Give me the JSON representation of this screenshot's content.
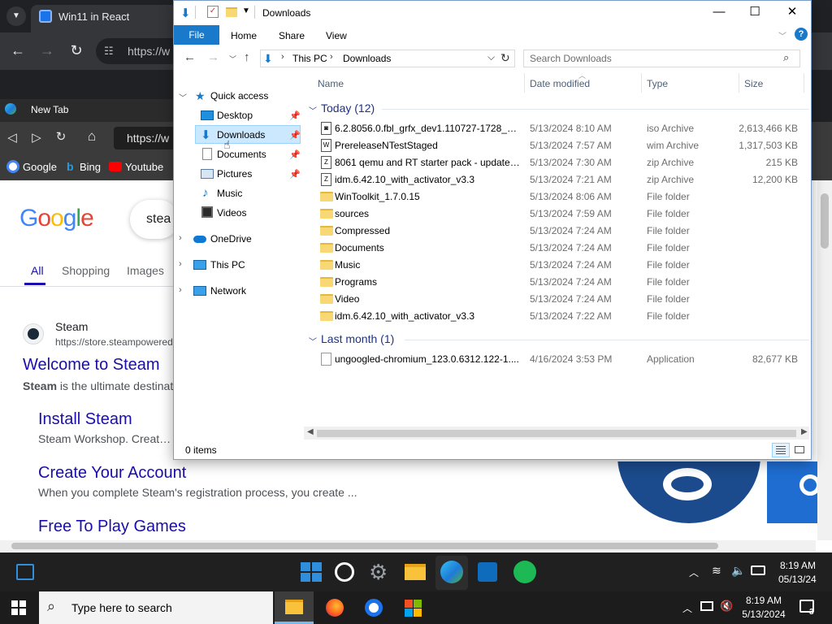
{
  "chrome": {
    "tab_title": "Win11 in React",
    "url": "https://w"
  },
  "edge": {
    "tab_title": "New Tab",
    "url": "https://w",
    "bookmarks": [
      "Google",
      "Bing",
      "Youtube"
    ]
  },
  "google": {
    "logo_letters": [
      "G",
      "o",
      "o",
      "g",
      "l",
      "e"
    ],
    "logo_colors": [
      "#4285f4",
      "#ea4335",
      "#fbbc05",
      "#4285f4",
      "#34a853",
      "#ea4335"
    ],
    "search_text": "stea",
    "tabs": [
      "All",
      "Shopping",
      "Images"
    ],
    "result": {
      "site_name": "Steam",
      "site_url": "https://store.steampowered",
      "title": "Welcome to Steam",
      "snippet_bold": "Steam",
      "snippet_rest": " is the ultimate destinat",
      "sublinks": [
        {
          "title": "Install Steam",
          "snippet": "Steam Workshop. Create, c"
        },
        {
          "title": "Create Your Account",
          "snippet": "When you complete Steam's registration process, you create ..."
        },
        {
          "title": "Free To Play Games",
          "snippet": ""
        }
      ]
    }
  },
  "explorer": {
    "title": "Downloads",
    "ribbon_tabs": [
      "File",
      "Home",
      "Share",
      "View"
    ],
    "help": "?",
    "breadcrumb": [
      "This PC",
      "Downloads"
    ],
    "search_placeholder": "Search Downloads",
    "nav": {
      "quick_access": "Quick access",
      "pinned": [
        "Desktop",
        "Downloads",
        "Documents",
        "Pictures"
      ],
      "unpinned": [
        "Music",
        "Videos"
      ],
      "onedrive": "OneDrive",
      "thispc": "This PC",
      "network": "Network"
    },
    "columns": [
      "Name",
      "Date modified",
      "Type",
      "Size"
    ],
    "groups": [
      {
        "label": "Today (12)",
        "files": [
          {
            "name": "6.2.8056.0.fbl_grfx_dev1.110727-1728_x86...",
            "date": "5/13/2024 8:10 AM",
            "type": "iso Archive",
            "size": "2,613,466 KB",
            "icon": "iso-file-icon"
          },
          {
            "name": "PrereleaseNTestStaged",
            "date": "5/13/2024 7:57 AM",
            "type": "wim Archive",
            "size": "1,317,503 KB",
            "icon": "wim-file-icon"
          },
          {
            "name": "8061 qemu and RT starter pack - updated...",
            "date": "5/13/2024 7:30 AM",
            "type": "zip Archive",
            "size": "215 KB",
            "icon": "zip-file-icon"
          },
          {
            "name": "idm.6.42.10_with_activator_v3.3",
            "date": "5/13/2024 7:21 AM",
            "type": "zip Archive",
            "size": "12,200 KB",
            "icon": "zip-file-icon"
          },
          {
            "name": "WinToolkit_1.7.0.15",
            "date": "5/13/2024 8:06 AM",
            "type": "File folder",
            "size": "",
            "icon": "folder-icon"
          },
          {
            "name": "sources",
            "date": "5/13/2024 7:59 AM",
            "type": "File folder",
            "size": "",
            "icon": "folder-icon"
          },
          {
            "name": "Compressed",
            "date": "5/13/2024 7:24 AM",
            "type": "File folder",
            "size": "",
            "icon": "folder-icon"
          },
          {
            "name": "Documents",
            "date": "5/13/2024 7:24 AM",
            "type": "File folder",
            "size": "",
            "icon": "folder-icon"
          },
          {
            "name": "Music",
            "date": "5/13/2024 7:24 AM",
            "type": "File folder",
            "size": "",
            "icon": "folder-icon"
          },
          {
            "name": "Programs",
            "date": "5/13/2024 7:24 AM",
            "type": "File folder",
            "size": "",
            "icon": "folder-icon"
          },
          {
            "name": "Video",
            "date": "5/13/2024 7:24 AM",
            "type": "File folder",
            "size": "",
            "icon": "folder-icon"
          },
          {
            "name": "idm.6.42.10_with_activator_v3.3",
            "date": "5/13/2024 7:22 AM",
            "type": "File folder",
            "size": "",
            "icon": "folder-icon"
          }
        ]
      },
      {
        "label": "Last month (1)",
        "files": [
          {
            "name": "ungoogled-chromium_123.0.6312.122-1....",
            "date": "4/16/2024 3:53 PM",
            "type": "Application",
            "size": "82,677 KB",
            "icon": "application-file-icon"
          }
        ]
      }
    ],
    "status": "0 items"
  },
  "taskbar11": {
    "time": "8:19 AM",
    "date": "05/13/24"
  },
  "taskbar10": {
    "search_placeholder": "Type here to search",
    "time": "8:19 AM",
    "date": "5/13/2024",
    "notifications": "3"
  }
}
